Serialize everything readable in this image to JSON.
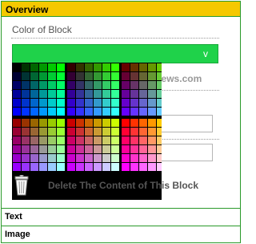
{
  "panel": {
    "title": "Overview",
    "color_section_label": "Color of Block",
    "color_select_arrow": "v",
    "selected_color": "#1fd24a",
    "url_partial": "w.news.com",
    "delete_label": "Delete The Content of This Block"
  },
  "rows": [
    {
      "label": "Text"
    },
    {
      "label": "Image"
    }
  ],
  "palette": {
    "blocks": 4,
    "levels": [
      0,
      51,
      102,
      153,
      204,
      255
    ],
    "open": true
  }
}
